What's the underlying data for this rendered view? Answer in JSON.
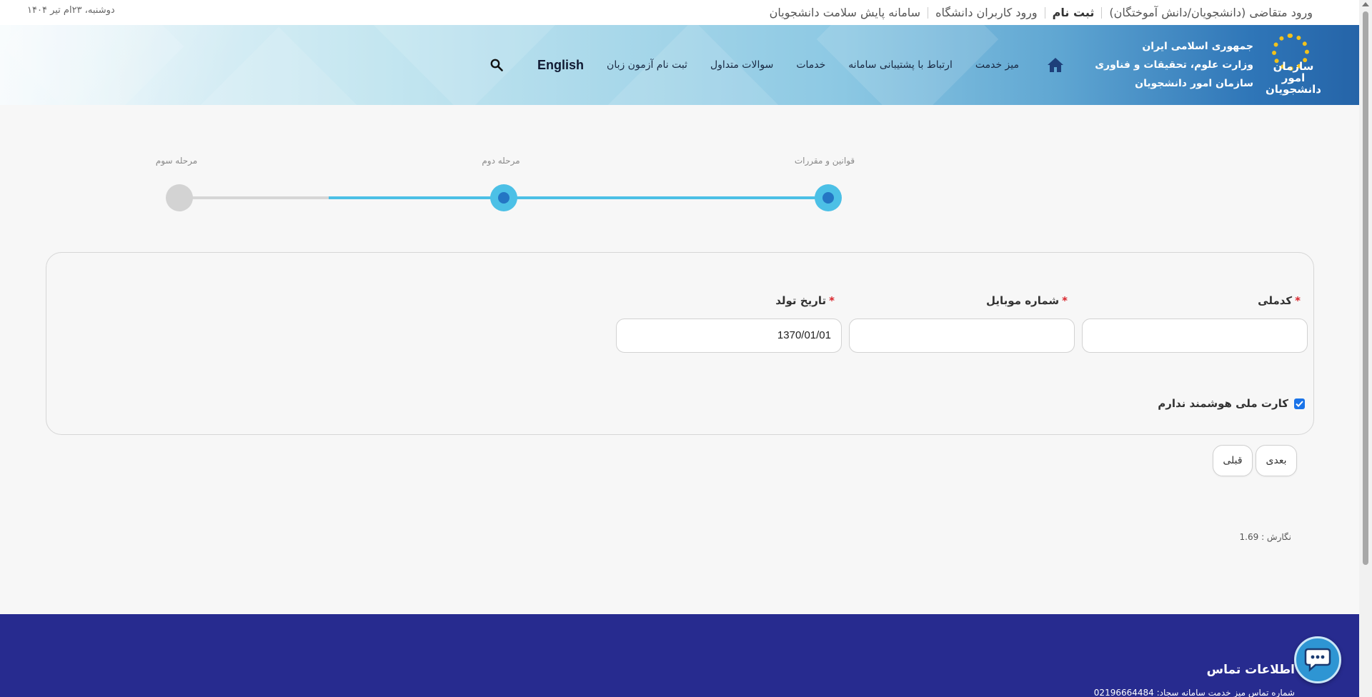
{
  "topbar": {
    "links": [
      {
        "label": "ورود متقاضی (دانشجویان/دانش آموختگان)",
        "bold": false
      },
      {
        "label": "ثبت نام",
        "bold": true
      },
      {
        "label": "ورود کاربران دانشگاه",
        "bold": false
      },
      {
        "label": "سامانه پایش سلامت دانشجویان",
        "bold": false
      }
    ],
    "date": "دوشنبه، ۲۳ام تیر ۱۴۰۴"
  },
  "brand": {
    "logo_text_1": "سازمان امور",
    "logo_text_2": "دانشجویان",
    "line1": "جمهوری اسلامی ایران",
    "line2": "وزارت علوم، تحقیقات و فناوری",
    "line3": "سازمان امور دانشجویان"
  },
  "nav": {
    "items": [
      "میز خدمت",
      "ارتباط با پشتیبانی سامانه",
      "خدمات",
      "سوالات متداول",
      "ثبت نام آزمون زبان"
    ],
    "english": "English"
  },
  "stepper": {
    "steps": [
      {
        "label": "قوانین و مقررات",
        "state": "done"
      },
      {
        "label": "مرحله دوم",
        "state": "current"
      },
      {
        "label": "مرحله سوم",
        "state": "pending"
      }
    ],
    "progress_fraction": 0.77
  },
  "form": {
    "national_code": {
      "label": "کدملی",
      "value": ""
    },
    "mobile": {
      "label": "شماره موبایل",
      "value": ""
    },
    "birthdate": {
      "label": "تاریخ تولد",
      "value": "1370/01/01"
    },
    "no_smart_card": {
      "label": "کارت ملی هوشمند ندارم",
      "checked": true
    }
  },
  "buttons": {
    "next": "بعدی",
    "prev": "قبلی"
  },
  "version": "نگارش : 1.69",
  "footer": {
    "title": "اطلاعات تماس",
    "line": "شماره تماس میز خدمت سامانه سجاد: 02196664484"
  },
  "colors": {
    "accent": "#4cc0e6",
    "accent_dark": "#2476c4",
    "footer": "#272b8f",
    "required": "#d9252c"
  }
}
